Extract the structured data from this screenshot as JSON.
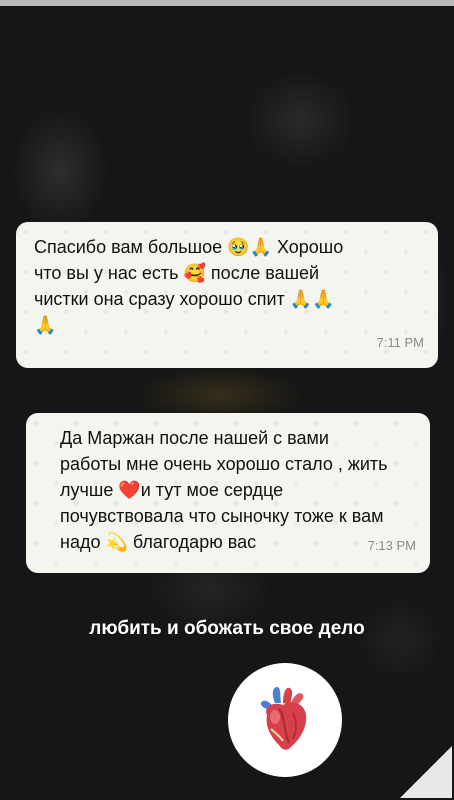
{
  "messages": [
    {
      "text": "Спасибо вам большое 🥹🙏 Хорошо\nчто вы у нас есть 🥰 после вашей\nчистки она сразу хорошо спит 🙏🙏\n🙏",
      "time": "7:11 PM"
    },
    {
      "text": "Да Маржан после нашей с вами\nработы мне очень хорошо стало , жить\nлучше ❤️и тут мое сердце\nпочувствовала что сыночку тоже к вам\nнадо 💫 благодарю вас",
      "time": "7:13 PM"
    }
  ],
  "caption": "любить и обожать свое дело",
  "sticker": {
    "icon": "anatomical-heart-icon"
  },
  "colors": {
    "bubble": "#f5f5f0",
    "background": "#161616",
    "caption": "#ffffff"
  }
}
